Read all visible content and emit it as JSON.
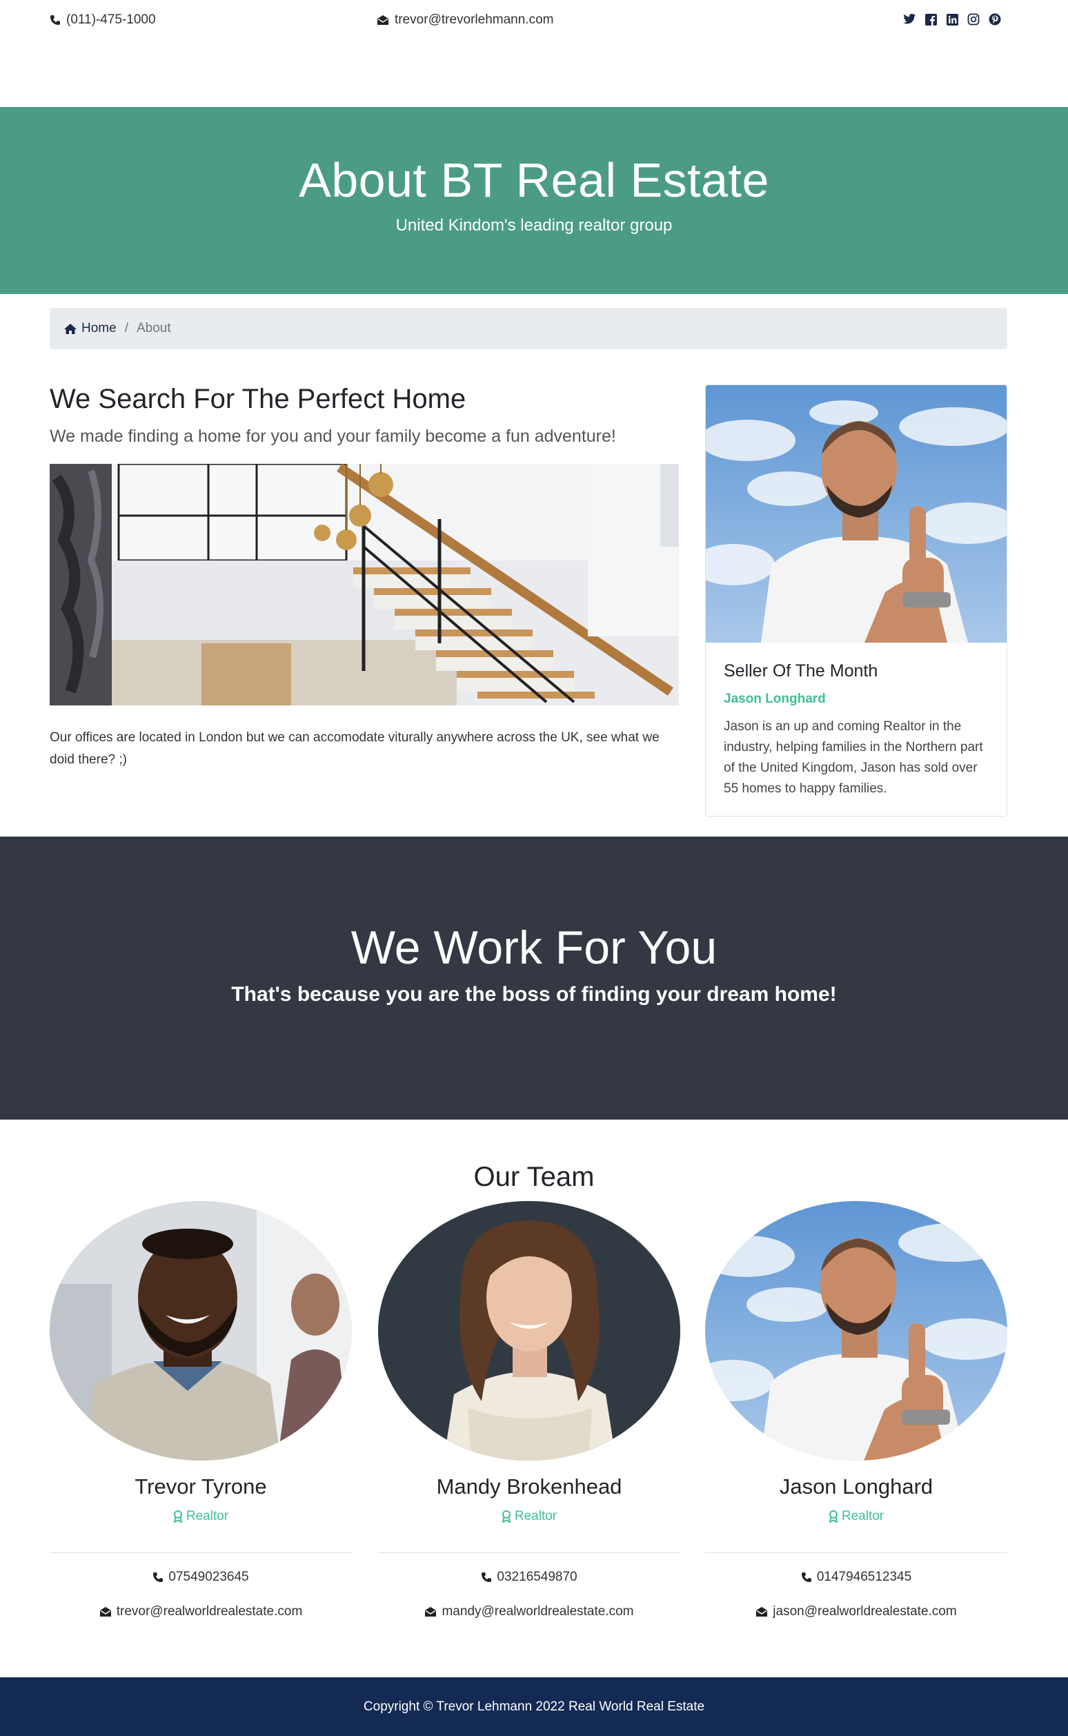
{
  "topbar": {
    "phone": "(011)-475-1000",
    "email": "trevor@trevorlehmann.com",
    "social_icons": [
      "twitter-icon",
      "facebook-icon",
      "linkedin-icon",
      "instagram-icon",
      "pinterest-icon"
    ]
  },
  "hero": {
    "title": "About BT Real Estate",
    "subtitle": "United Kindom's leading realtor group"
  },
  "breadcrumb": {
    "home_label": "Home",
    "separator": "/",
    "current": "About"
  },
  "intro": {
    "title": "We Search For The Perfect Home",
    "lead": "We made finding a home for you and your family become a fun adventure!",
    "text": "Our offices are located in London but we can accomodate viturally anywhere across the UK, see what we doid there? ;)"
  },
  "seller": {
    "title": "Seller Of The Month",
    "name": "Jason Longhard",
    "description": "Jason is an up and coming Realtor in the industry, helping families in the Northern part of the United Kingdom, Jason has sold over 55 homes to happy families."
  },
  "band": {
    "title": "We Work For You",
    "subtitle": "That's because you are the boss of finding your dream home!"
  },
  "team": {
    "heading": "Our Team",
    "members": [
      {
        "name": "Trevor Tyrone",
        "role": "Realtor",
        "phone": "07549023645",
        "email": "trevor@realworldrealestate.com"
      },
      {
        "name": "Mandy Brokenhead",
        "role": "Realtor",
        "phone": "03216549870",
        "email": "mandy@realworldrealestate.com"
      },
      {
        "name": "Jason Longhard",
        "role": "Realtor",
        "phone": "0147946512345",
        "email": "jason@realworldrealestate.com"
      }
    ]
  },
  "footer": {
    "copyright": "Copyright © Trevor Lehmann 2022 Real World Real Estate"
  },
  "colors": {
    "hero_bg": "#4c9c85",
    "accent_green": "#3fbf95",
    "band_bg": "#333842",
    "footer_bg": "#132a55"
  }
}
